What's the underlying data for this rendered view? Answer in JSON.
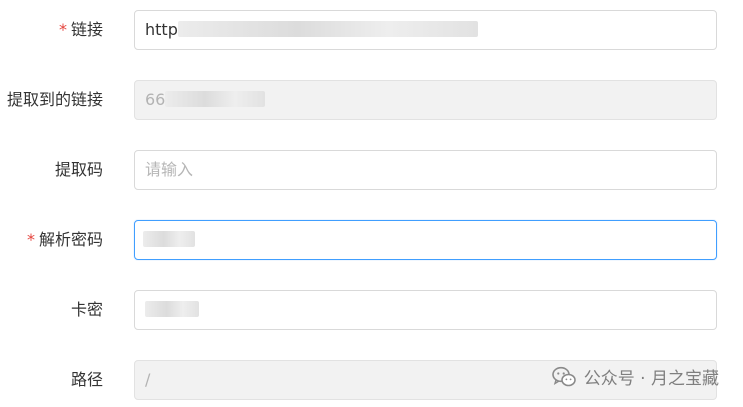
{
  "form": {
    "fields": [
      {
        "label": "链接",
        "required": true,
        "value": "http",
        "masked": true,
        "state": "normal"
      },
      {
        "label": "提取到的链接",
        "required": false,
        "value": "66",
        "masked": true,
        "state": "disabled"
      },
      {
        "label": "提取码",
        "required": false,
        "value": "",
        "placeholder": "请输入",
        "state": "normal"
      },
      {
        "label": "解析密码",
        "required": true,
        "value": "",
        "masked": true,
        "state": "focused"
      },
      {
        "label": "卡密",
        "required": false,
        "value": "",
        "masked": true,
        "state": "normal"
      },
      {
        "label": "路径",
        "required": false,
        "value": "/",
        "state": "disabled"
      }
    ],
    "required_mark": "*"
  },
  "watermark": {
    "text": "公众号 · 月之宝藏",
    "icon": "wechat-icon"
  },
  "colors": {
    "required": "#e5443d",
    "focus_border": "#409eff",
    "disabled_bg": "#f2f2f2"
  }
}
